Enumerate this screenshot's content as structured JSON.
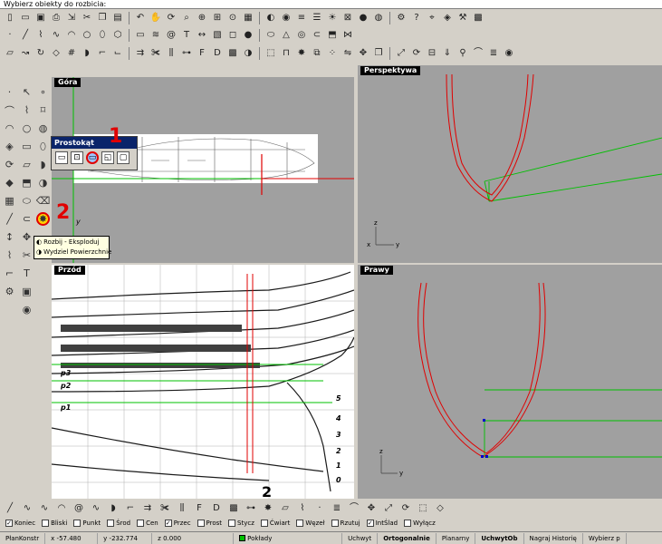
{
  "command_prompt": "Wybierz obiekty do rozbicia:",
  "toolbar_rows": [
    [
      "new-icon",
      "open-icon",
      "save-icon",
      "print-icon",
      "import-icon",
      "cut-icon",
      "copy-icon",
      "paste-icon",
      "undo-icon",
      "pan-icon",
      "rotate-icon",
      "zoom-icon",
      "zoom-window-icon",
      "zoom-extents-icon",
      "zoom-selected-icon",
      "grid-icon",
      "shade-icon",
      "render-icon",
      "layers-icon",
      "properties-icon",
      "lightbulb-icon",
      "lock-icon",
      "sphere-icon",
      "globe-icon",
      "gear-icon",
      "help-icon",
      "snap-icon",
      "object-icon",
      "tools-icon",
      "mesh-icon"
    ],
    [
      "point-icon",
      "line-icon",
      "polyline-icon",
      "curve-icon",
      "arc-icon",
      "circle-icon",
      "ellipse-icon",
      "polygon-icon",
      "rectangle-icon",
      "helix-icon",
      "spiral-icon",
      "text-icon",
      "dimension-icon",
      "hatch-icon",
      "box-icon",
      "sphere-icon",
      "cylinder-icon",
      "cone-icon",
      "torus-icon",
      "pipe-icon",
      "extrude-icon",
      "loft-icon"
    ],
    [
      "surface-icon",
      "sweep-icon",
      "revolve-icon",
      "patch-icon",
      "network-icon",
      "blend-icon",
      "fillet-icon",
      "chamfer-icon",
      "offset-icon",
      "trim-icon",
      "split-icon",
      "join-icon",
      "fit-icon",
      "deg-icon",
      "mesh-icon",
      "boolean-icon",
      "shell-icon",
      "cap-icon",
      "explode-icon",
      "group-icon",
      "array-icon",
      "mirror-icon",
      "move-icon",
      "copy-icon",
      "scale-icon",
      "rotate-icon",
      "align-icon",
      "project-icon",
      "analyze-icon",
      "curvature-icon",
      "zebra-icon",
      "render-icon"
    ]
  ],
  "viewports": {
    "top": {
      "title": "Góra"
    },
    "perspective": {
      "title": "Perspektywa"
    },
    "front": {
      "title": "Przód"
    },
    "right": {
      "title": "Prawy"
    }
  },
  "popup": {
    "title": "Prostokąt"
  },
  "tooltip": {
    "line1": "Rozbij - Eksploduj",
    "line2": "Wydziel Powierzchnie"
  },
  "annotations": {
    "one": "1",
    "two": "2"
  },
  "osnap": [
    {
      "label": "Koniec",
      "checked": true
    },
    {
      "label": "Bliski",
      "checked": false
    },
    {
      "label": "Punkt",
      "checked": false
    },
    {
      "label": "Środ",
      "checked": false
    },
    {
      "label": "Cen",
      "checked": false
    },
    {
      "label": "Przec",
      "checked": true
    },
    {
      "label": "Prost",
      "checked": false
    },
    {
      "label": "Stycz",
      "checked": false
    },
    {
      "label": "Ćwiart",
      "checked": false
    },
    {
      "label": "Węzeł",
      "checked": false
    },
    {
      "label": "Rzutuj",
      "checked": false
    },
    {
      "label": "IntŚlad",
      "checked": true
    },
    {
      "label": "Wyłącz",
      "checked": false
    }
  ],
  "status": {
    "cplane": "PłanKonstr",
    "x": "x -57.480",
    "y": "y -232.774",
    "z": "z 0.000",
    "layer": "Pokłady",
    "layer_color": "#00c000",
    "snap": "Uchwyt",
    "ortho": "Ortogonalnie",
    "planar": "Planarny",
    "osnap": "UchwytOb",
    "history": "Nagraj Historię",
    "filter": "Wybierz p"
  },
  "axis_labels": {
    "x": "x",
    "y": "y",
    "z": "z"
  },
  "front_view_labels": {
    "p3": "p3",
    "p2": "p2",
    "p1": "p1",
    "n5": "5",
    "n4": "4",
    "n3": "3",
    "n2": "2",
    "n1": "1",
    "n0": "0",
    "n2big": "2"
  },
  "colors": {
    "curve": "#e00000",
    "guide": "#00c000",
    "viewport_bg": "#a0a0a0",
    "title_bg": "#0a246a"
  }
}
